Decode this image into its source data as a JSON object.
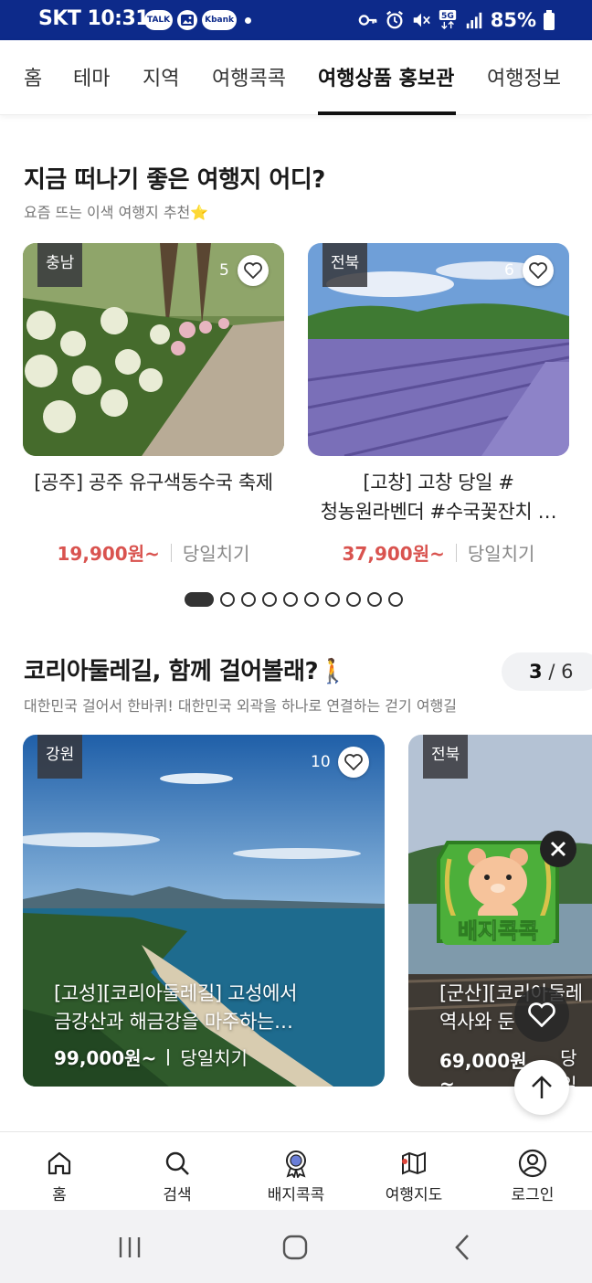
{
  "status_bar": {
    "carrier_time": "SKT 10:31",
    "notif_badges": [
      "TALK",
      "",
      "Kbank"
    ],
    "network": "5G",
    "battery": "85%"
  },
  "top_nav": {
    "tabs": [
      {
        "label": "홈"
      },
      {
        "label": "테마"
      },
      {
        "label": "지역"
      },
      {
        "label": "여행콕콕"
      },
      {
        "label": "여행상품 홍보관",
        "active": true
      },
      {
        "label": "여행정보"
      }
    ]
  },
  "section1": {
    "title": "지금 떠나기 좋은 여행지 어디?",
    "subtitle": "요즘 뜨는 이색 여행지 추천⭐",
    "cards": [
      {
        "region": "충남",
        "likes": "5",
        "title": "[공주] 공주 유구색동수국 축제",
        "price": "19,900원~",
        "type": "당일치기"
      },
      {
        "region": "전북",
        "likes": "6",
        "title_line1": "[고창] 고창 당일 #",
        "title_line2": "청농원라벤더 #수국꽃잔치 …",
        "price": "37,900원~",
        "type": "당일치기"
      }
    ],
    "pager_total": 10,
    "pager_active": 0
  },
  "section2": {
    "title": "코리아둘레길, 함께 걸어볼래?🚶",
    "subtitle": "대한민국 걸어서 한바퀴! 대한민국 외곽을 하나로 연결하는 걷기 여행길",
    "counter_current": "3",
    "counter_total": "/ 6",
    "cards": [
      {
        "region": "강원",
        "likes": "10",
        "title_line1": "[고성][코리아둘레길] 고성에서",
        "title_line2": "금강산과 해금강을 마주하는…",
        "price": "99,000원~",
        "type": "당일치기"
      },
      {
        "region": "전북",
        "title_line1": "[군산][코리아둘레",
        "title_line2": "역사와 둔",
        "price": "69,000원~",
        "type": "당일"
      }
    ]
  },
  "badge_popup": {
    "label": "배지콕콕"
  },
  "bottom_nav": [
    {
      "label": "홈",
      "icon": "home-icon"
    },
    {
      "label": "검색",
      "icon": "search-icon"
    },
    {
      "label": "배지콕콕",
      "icon": "badge-icon"
    },
    {
      "label": "여행지도",
      "icon": "map-icon"
    },
    {
      "label": "로그인",
      "icon": "user-icon"
    }
  ],
  "colors": {
    "status_bar": "#0d2a8a",
    "price": "#d9534f",
    "badge_green": "#4caf3a"
  }
}
